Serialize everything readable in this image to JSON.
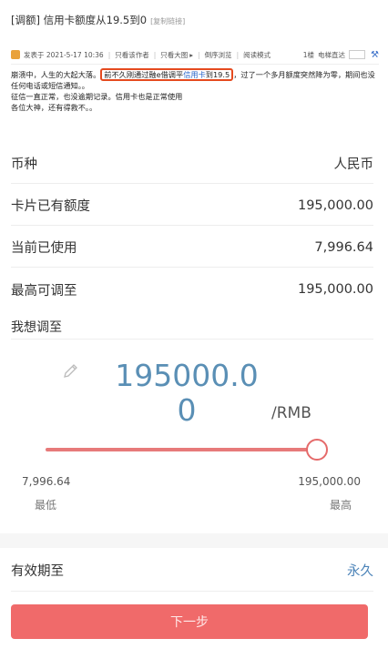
{
  "post": {
    "title": "[调额] 信用卡额度从19.5到0",
    "copy_link": "[复制链接]",
    "meta": {
      "posted": "发表于 2021-5-17 10:36",
      "only_author": "只看该作者",
      "only_big_image": "只看大图",
      "reverse": "倒序浏览",
      "read_mode": "阅读模式",
      "floor": "1楼",
      "jump": "电梯直达"
    },
    "body": {
      "part1": "崩溃中，人生的大起大落。",
      "highlight_prefix": "前不久刚通过融e借调平",
      "highlight_link": "信用卡",
      "highlight_suffix": "到19.5",
      "part2": "，过了一个多月额度突然降为零，期间也没任何电话或短信通知。。",
      "line2": "征信一直正常，也没逾期记录。信用卡也是正常使用",
      "line3": "各位大神，还有得救不。。"
    }
  },
  "form": {
    "currency_label": "币种",
    "currency_value": "人民币",
    "existing_label": "卡片已有额度",
    "existing_value": "195,000.00",
    "used_label": "当前已使用",
    "used_value": "7,996.64",
    "max_label": "最高可调至",
    "max_value": "195,000.00",
    "adjust_title": "我想调至",
    "amount_line1": "195000.0",
    "amount_line2": "0",
    "unit": "/RMB",
    "slider_fraction": 1.0,
    "min_value": "7,996.64",
    "min_label": "最低",
    "max_range_value": "195,000.00",
    "max_range_label": "最高",
    "expiry_label": "有效期至",
    "expiry_value": "永久",
    "next_button": "下一步"
  },
  "colors": {
    "accent_red": "#f06a6a",
    "amount_blue": "#5a8fb5",
    "link_blue": "#4b83b8",
    "highlight_border": "#e54a1f"
  }
}
